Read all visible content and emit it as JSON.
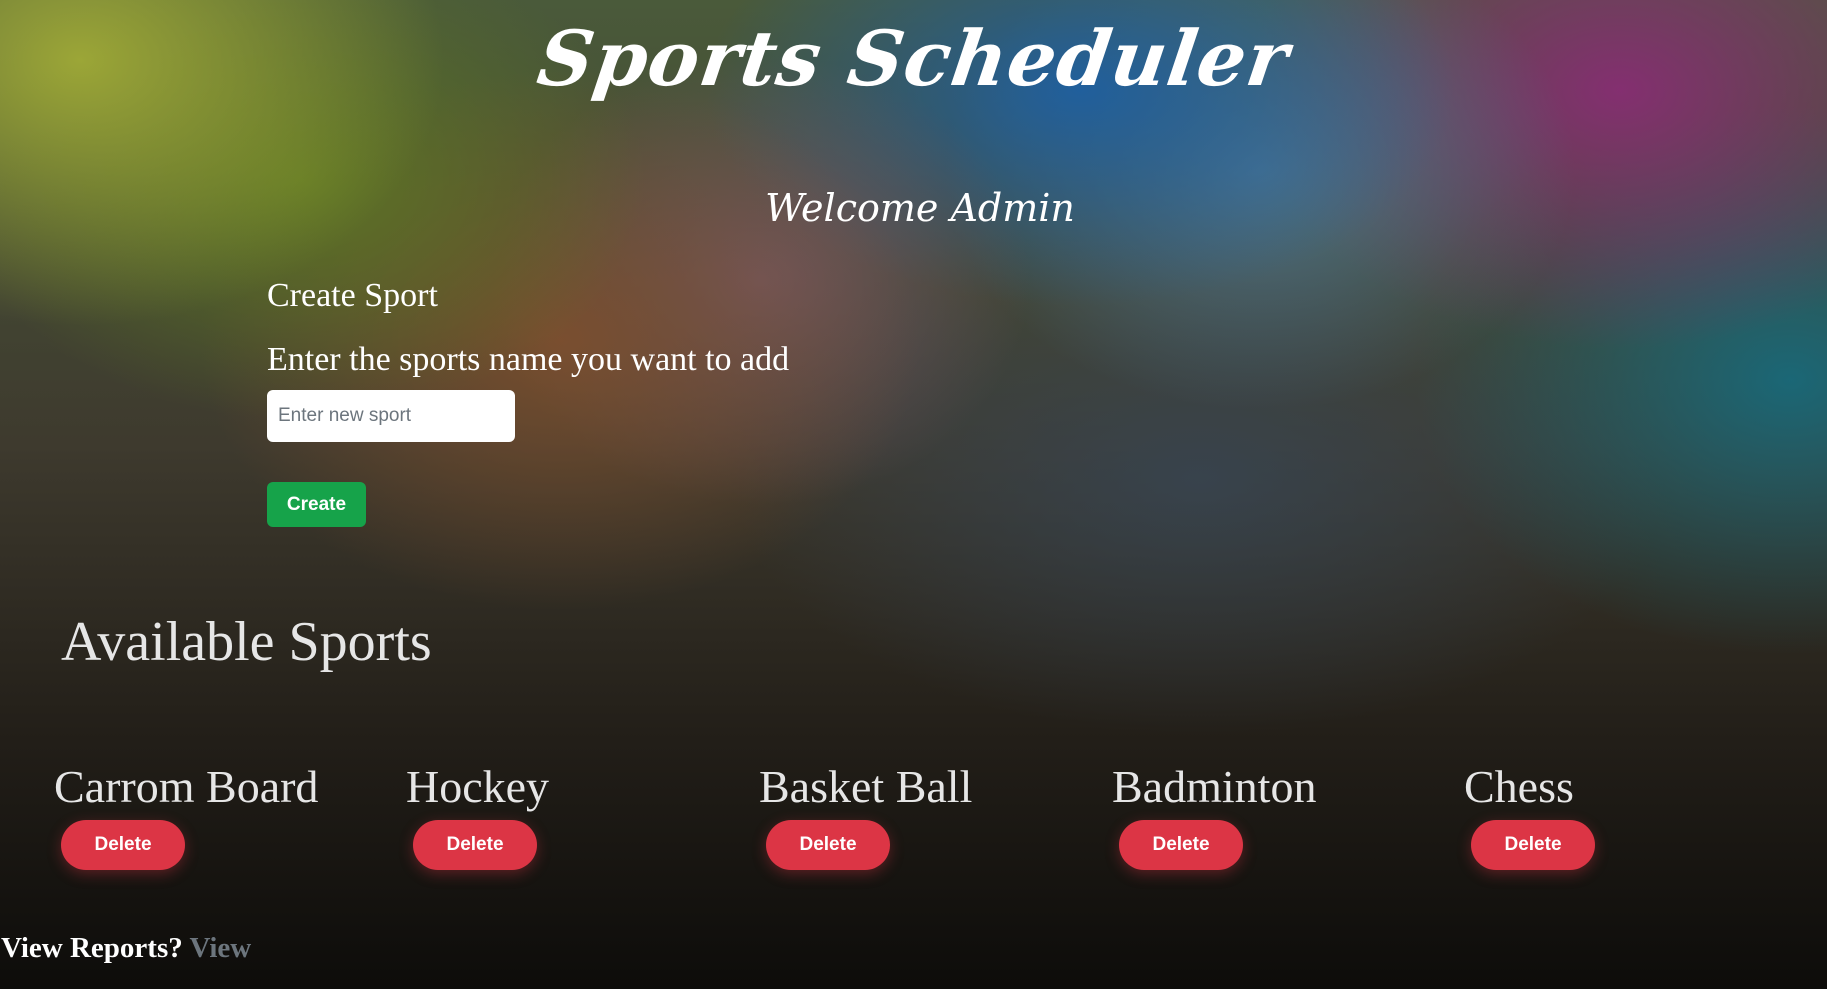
{
  "header": {
    "title": "Sports Scheduler",
    "welcome": "Welcome Admin"
  },
  "create_sport": {
    "heading": "Create Sport",
    "prompt": "Enter the sports name you want to add",
    "input_value": "",
    "input_placeholder": "Enter new sport",
    "create_label": "Create"
  },
  "available_sports": {
    "heading": "Available Sports",
    "items": [
      {
        "name": "Carrom Board",
        "delete_label": "Delete"
      },
      {
        "name": "Hockey",
        "delete_label": "Delete"
      },
      {
        "name": "Basket Ball",
        "delete_label": "Delete"
      },
      {
        "name": "Badminton",
        "delete_label": "Delete"
      },
      {
        "name": "Chess",
        "delete_label": "Delete"
      }
    ]
  },
  "footer": {
    "reports_label": "View Reports?",
    "reports_link": "View"
  },
  "colors": {
    "create_button": "#16a34a",
    "delete_button": "#dc3545",
    "link_muted": "#6c757d"
  }
}
